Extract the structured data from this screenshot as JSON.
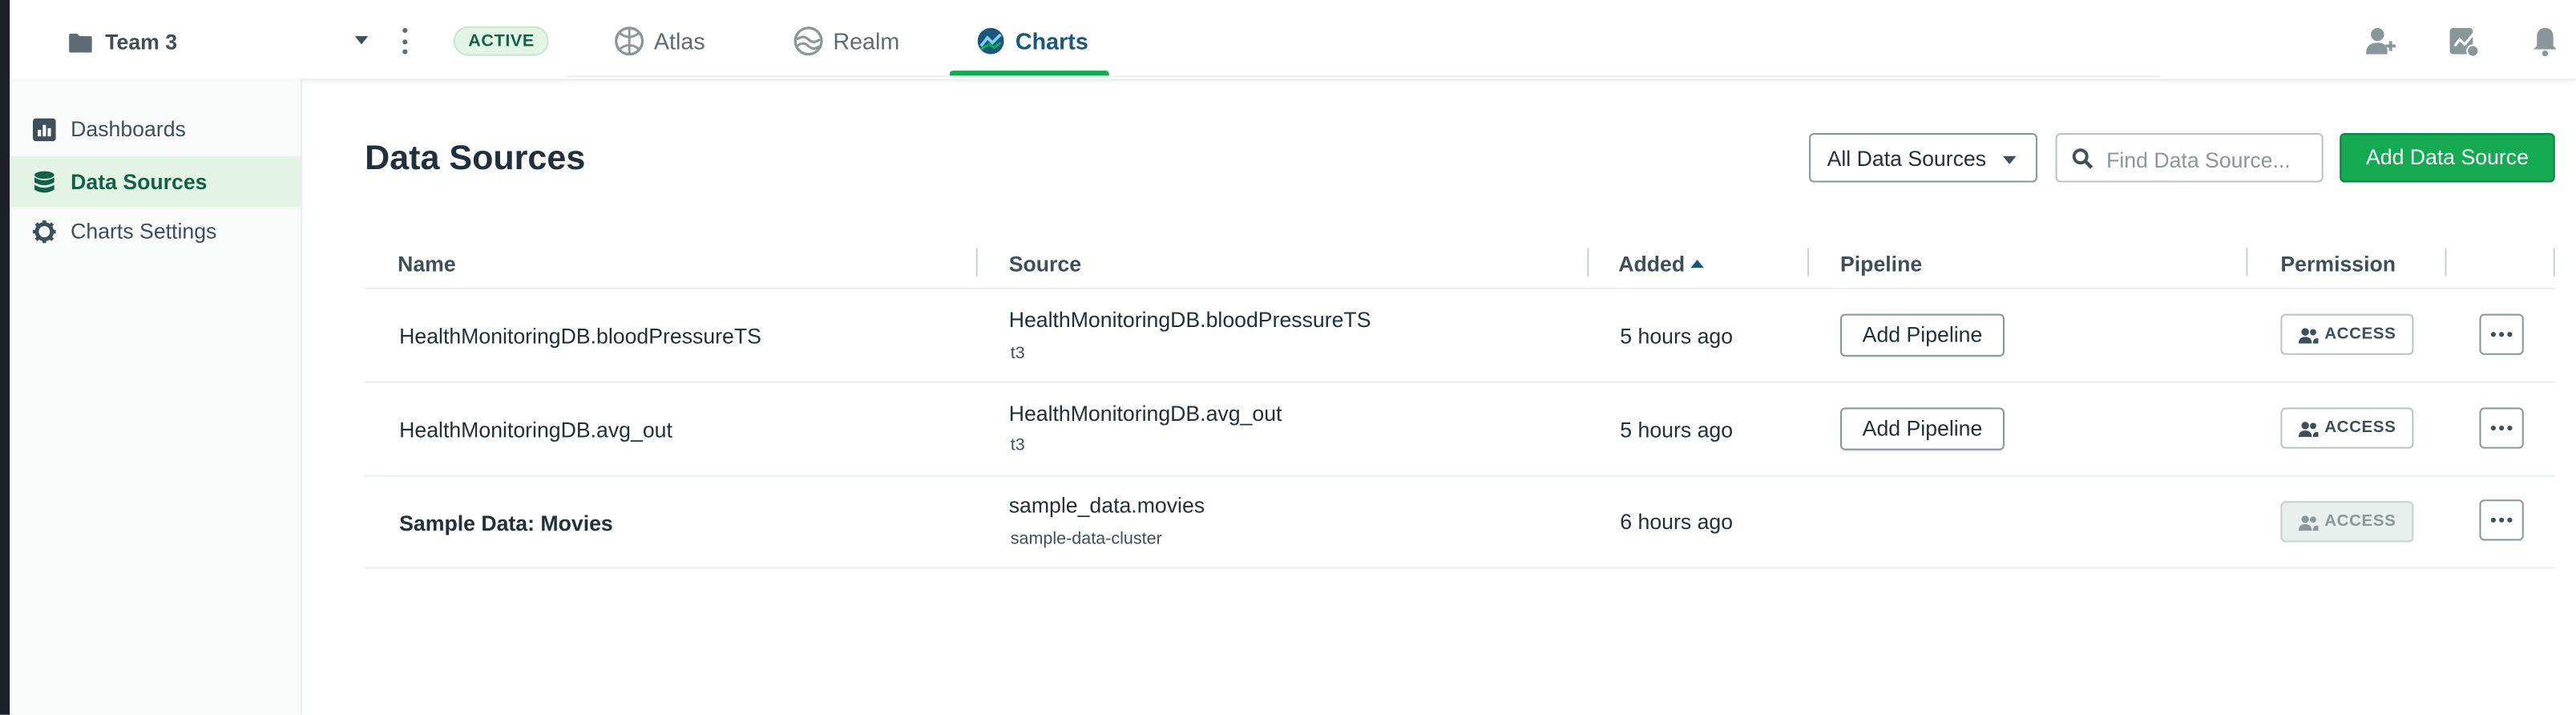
{
  "colors": {
    "accent_green": "#13aa52",
    "active_tab": "#1a567e",
    "sidebar_bg": "#f9fbfa"
  },
  "topbar": {
    "org_name": "Team 3",
    "status_badge": "ACTIVE",
    "tabs": [
      {
        "label": "Atlas",
        "icon": "atlas-icon",
        "active": false
      },
      {
        "label": "Realm",
        "icon": "realm-icon",
        "active": false
      },
      {
        "label": "Charts",
        "icon": "charts-icon",
        "active": true
      }
    ],
    "right_icons": [
      "invite-user-icon",
      "activity-feed-icon",
      "bell-icon"
    ]
  },
  "sidebar": {
    "items": [
      {
        "label": "Dashboards",
        "icon": "dashboard-icon",
        "active": false
      },
      {
        "label": "Data Sources",
        "icon": "database-icon",
        "active": true
      },
      {
        "label": "Charts Settings",
        "icon": "gear-icon",
        "active": false
      }
    ]
  },
  "main": {
    "title": "Data Sources",
    "filter_select": "All Data Sources",
    "search_placeholder": "Find Data Source...",
    "add_button": "Add Data Source",
    "columns": [
      "Name",
      "Source",
      "Added",
      "Pipeline",
      "Permission"
    ],
    "sort": {
      "column": "Added",
      "direction": "ascending"
    },
    "rows": [
      {
        "name": "HealthMonitoringDB.bloodPressureTS",
        "source": "HealthMonitoringDB.bloodPressureTS",
        "cluster": "t3",
        "added": "5 hours ago",
        "pipeline_button": "Add Pipeline",
        "access": "ACCESS",
        "access_enabled": true
      },
      {
        "name": "HealthMonitoringDB.avg_out",
        "source": "HealthMonitoringDB.avg_out",
        "cluster": "t3",
        "added": "5 hours ago",
        "pipeline_button": "Add Pipeline",
        "access": "ACCESS",
        "access_enabled": true
      },
      {
        "name": "Sample Data: Movies",
        "source": "sample_data.movies",
        "cluster": "sample-data-cluster",
        "added": "6 hours ago",
        "pipeline_button": "",
        "access": "ACCESS",
        "access_enabled": false
      }
    ]
  }
}
